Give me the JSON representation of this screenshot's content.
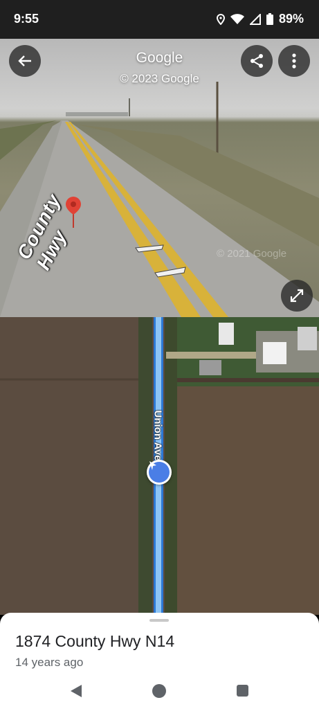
{
  "status_bar": {
    "time": "9:55",
    "battery": "89%"
  },
  "street_view": {
    "title": "Google",
    "copyright": "© 2023 Google",
    "watermark": "© 2021 Google",
    "road_label": "County Hwy"
  },
  "map": {
    "street_name": "Union Ave"
  },
  "place": {
    "title": "1874 County Hwy N14",
    "subtitle": "14 years ago"
  },
  "colors": {
    "accent": "#4a7ee6",
    "status_bar_bg": "#1f1f1f",
    "map_road": "#8ec5f5"
  }
}
